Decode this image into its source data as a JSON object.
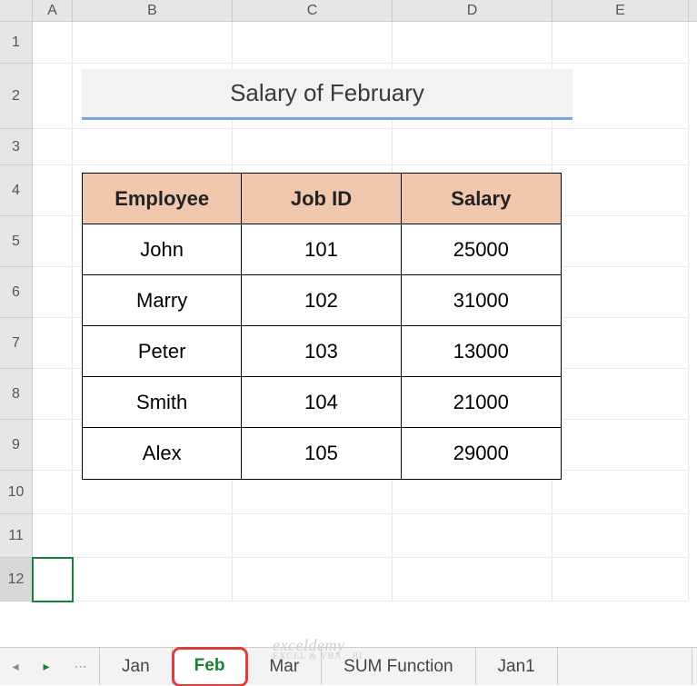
{
  "columns": [
    "A",
    "B",
    "C",
    "D",
    "E"
  ],
  "row_numbers": [
    1,
    2,
    3,
    4,
    5,
    6,
    7,
    8,
    9,
    10,
    11,
    12
  ],
  "active_cell": "A12",
  "title": "Salary of February",
  "table": {
    "headers": [
      "Employee",
      "Job ID",
      "Salary"
    ],
    "rows": [
      {
        "employee": "John",
        "job_id": "101",
        "salary": "25000"
      },
      {
        "employee": "Marry",
        "job_id": "102",
        "salary": "31000"
      },
      {
        "employee": "Peter",
        "job_id": "103",
        "salary": "13000"
      },
      {
        "employee": "Smith",
        "job_id": "104",
        "salary": "21000"
      },
      {
        "employee": "Alex",
        "job_id": "105",
        "salary": "29000"
      }
    ]
  },
  "watermark": {
    "main": "exceldemy",
    "sub": "EXCEL & VBA · BI"
  },
  "tabs": {
    "items": [
      "Jan",
      "Feb",
      "Mar",
      "SUM Function",
      "Jan1"
    ],
    "active": "Feb",
    "highlighted": "Feb"
  },
  "nav_glyphs": {
    "first": "◂",
    "play": "▸",
    "dots": "⋯"
  },
  "colors": {
    "table_header_bg": "#efc8ad",
    "active_tab_text": "#1a7f37",
    "highlight_outline": "#e23b3b",
    "title_underline": "#7aa7d9"
  }
}
